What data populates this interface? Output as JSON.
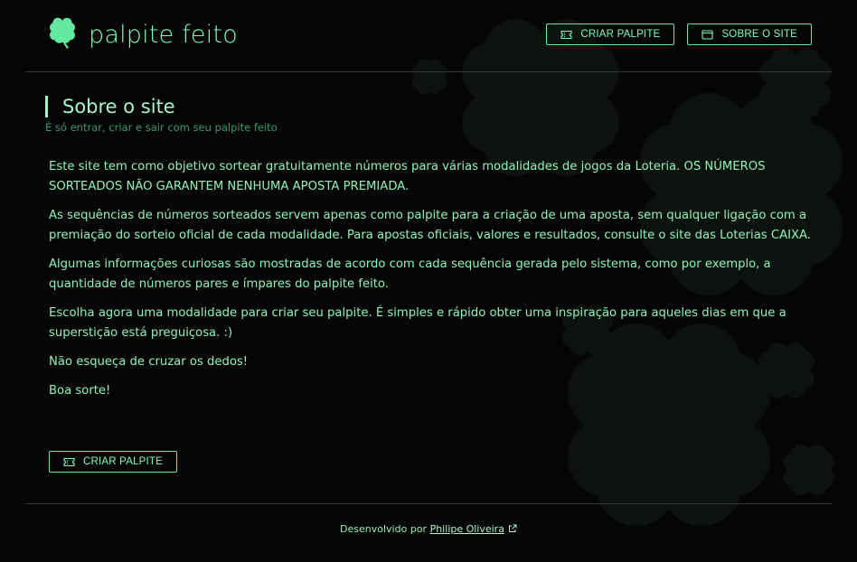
{
  "brand": {
    "name": "palpite feito",
    "icon": "clover-icon"
  },
  "nav": {
    "create_label": "CRIAR PALPITE",
    "create_icon": "ticket-icon",
    "about_label": "SOBRE O SITE",
    "about_icon": "window-icon"
  },
  "page": {
    "title": "Sobre o site",
    "subtitle": "É só entrar, criar e sair com seu palpite feito",
    "paragraphs": [
      "Este site tem como objetivo sortear gratuitamente números para várias modalidades de jogos da Loteria. OS NÚMEROS SORTEADOS NÃO GARANTEM NENHUMA APOSTA PREMIADA.",
      "As sequências de números sorteados servem apenas como palpite para a criação de uma aposta, sem qualquer ligação com a premiação do sorteio oficial de cada modalidade. Para apostas oficiais, valores e resultados, consulte o site das Loterias CAIXA.",
      "Algumas informações curiosas são mostradas de acordo com cada sequência gerada pelo sistema, como por exemplo, a quantidade de números pares e ímpares do palpite feito.",
      "Escolha agora uma modalidade para criar seu palpite. É simples e rápido obter uma inspiração para aqueles dias em que a superstição está preguiçosa. :)",
      "Não esqueça de cruzar os dedos!",
      "Boa sorte!"
    ],
    "cta_label": "CRIAR PALPITE"
  },
  "footer": {
    "prefix": "Desenvolvido por",
    "author": "Philipe Oliveira",
    "link_icon": "external-link-icon"
  },
  "colors": {
    "accent": "#7dffb7",
    "background": "#050505",
    "text": "#8ef0b6",
    "divider": "#2f3a33"
  }
}
